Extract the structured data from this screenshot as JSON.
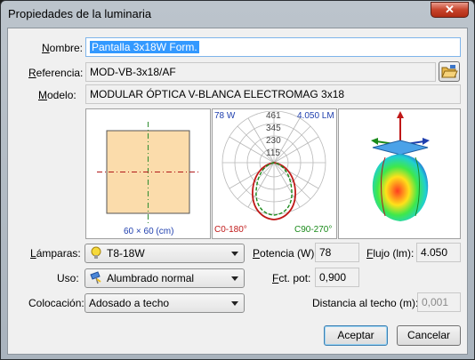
{
  "window": {
    "title": "Propiedades de la luminaria",
    "close_symbol": "✕"
  },
  "nombre": {
    "label_u": "N",
    "label_rest": "ombre:",
    "value": "Pantalla 3x18W Form."
  },
  "referencia": {
    "label_u": "R",
    "label_rest": "eferencia:",
    "value": "MOD-VB-3x18/AF"
  },
  "modelo": {
    "label_u": "M",
    "label_rest": "odelo:",
    "value": "MODULAR ÓPTICA V-BLANCA ELECTROMAG 3x18"
  },
  "plan_view": {
    "caption": "60 × 60 (cm)"
  },
  "polar": {
    "watts": "78 W",
    "lumens": "4.050 LM",
    "rings": [
      "461",
      "345",
      "230",
      "115"
    ],
    "c0": "C0-180°",
    "c90": "C90-270°"
  },
  "lamparas": {
    "label_u": "L",
    "label_rest": "ámparas:",
    "value": "T8-18W"
  },
  "uso": {
    "label": "Uso:",
    "value": "Alumbrado normal"
  },
  "colocacion": {
    "label": "Colocación:",
    "value": "Adosado a techo"
  },
  "potencia": {
    "label_u": "P",
    "label_rest": "otencia (W):",
    "value": "78"
  },
  "flujo": {
    "label_u": "F",
    "label_rest": "lujo (lm):",
    "value": "4.050"
  },
  "fct_pot": {
    "label_u": "F",
    "label_rest": "ct. pot:",
    "value": "0,900"
  },
  "distancia": {
    "label": "Distancia al techo (m):",
    "value": "0,001"
  },
  "buttons": {
    "accept": "Aceptar",
    "cancel": "Cancelar"
  }
}
